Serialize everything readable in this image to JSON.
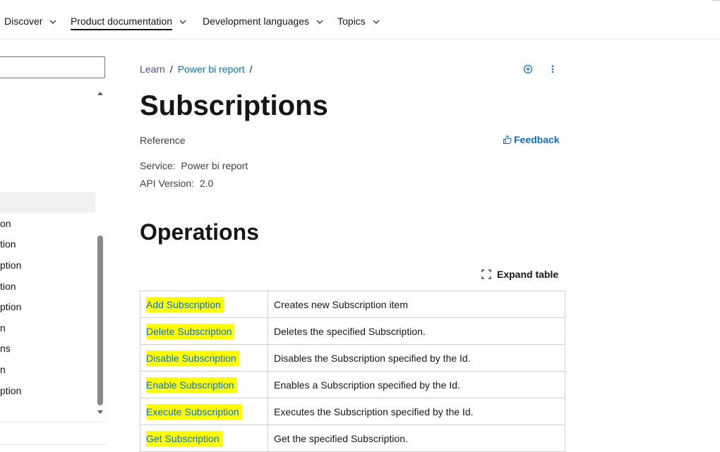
{
  "nav": {
    "items": [
      {
        "label": "Discover",
        "active": false
      },
      {
        "label": "Product documentation",
        "active": true
      },
      {
        "label": "Development languages",
        "active": false
      },
      {
        "label": "Topics",
        "active": false
      }
    ]
  },
  "sidebar": {
    "search_placeholder": "",
    "items": [
      {
        "label": "on"
      },
      {
        "label": "tion"
      },
      {
        "label": "ption"
      },
      {
        "label": "tion"
      },
      {
        "label": "ption"
      },
      {
        "label": "n"
      },
      {
        "label": "ns"
      },
      {
        "label": "n"
      },
      {
        "label": "ption"
      }
    ]
  },
  "breadcrumb": [
    "Learn",
    "Power bi report"
  ],
  "page": {
    "title": "Subscriptions",
    "type": "Reference",
    "feedback": "Feedback",
    "service_label": "Service:",
    "service_value": "Power bi report",
    "api_label": "API Version:",
    "api_value": "2.0"
  },
  "operations": {
    "title": "Operations",
    "expand_label": "Expand table",
    "rows": [
      {
        "name": "Add Subscription",
        "description": "Creates new Subscription item"
      },
      {
        "name": "Delete Subscription",
        "description": "Deletes the specified Subscription."
      },
      {
        "name": "Disable Subscription",
        "description": "Disables the Subscription specified by the Id."
      },
      {
        "name": "Enable Subscription",
        "description": "Enables a Subscription specified by the Id."
      },
      {
        "name": "Execute Subscription",
        "description": "Executes the Subscription specified by the Id."
      },
      {
        "name": "Get Subscription",
        "description": "Get the specified Subscription."
      }
    ]
  },
  "colors": {
    "link": "#0f6cbd",
    "highlight": "#ffff00"
  }
}
